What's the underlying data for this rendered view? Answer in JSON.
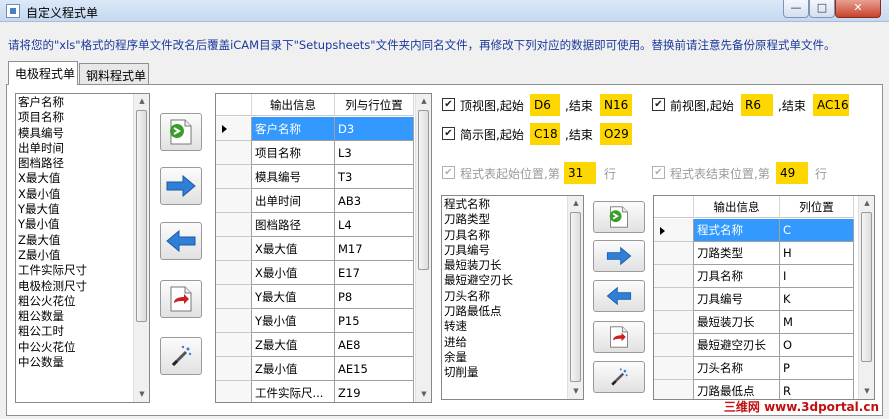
{
  "window": {
    "title": "自定义程式单",
    "min_symbol": "—",
    "max_symbol": "□",
    "close_symbol": "✕"
  },
  "notice": "请将您的\"xls\"格式的程序单文件改名后覆盖iCAM目录下\"Setupsheets\"文件夹内同名文件，再修改下列对应的数据即可使用。替换前请注意先备份原程式单文件。",
  "tabs": [
    {
      "label": "电极程式单",
      "active": true
    },
    {
      "label": "钢料程式单",
      "active": false
    }
  ],
  "left_list": [
    "客户名称",
    "项目名称",
    "模具编号",
    "出单时间",
    "图档路径",
    "X最大值",
    "X最小值",
    "Y最大值",
    "Y最小值",
    "Z最大值",
    "Z最小值",
    "工件实际尺寸",
    "电极检测尺寸",
    "粗公火花位",
    "粗公数量",
    "粗公工时",
    "中公火花位",
    "中公数量"
  ],
  "output_grid": {
    "headers": [
      "输出信息",
      "列与行位置"
    ],
    "rows": [
      [
        "客户名称",
        "D3"
      ],
      [
        "项目名称",
        "L3"
      ],
      [
        "模具编号",
        "T3"
      ],
      [
        "出单时间",
        "AB3"
      ],
      [
        "图档路径",
        "L4"
      ],
      [
        "X最大值",
        "M17"
      ],
      [
        "X最小值",
        "E17"
      ],
      [
        "Y最大值",
        "P8"
      ],
      [
        "Y最小值",
        "P15"
      ],
      [
        "Z最大值",
        "AE8"
      ],
      [
        "Z最小值",
        "AE15"
      ],
      [
        "工件实际尺...",
        "Z19"
      ]
    ],
    "selected_row": 0
  },
  "views": {
    "top": {
      "label": "顶视图,起始",
      "start": "D6",
      "end_label": ",结束",
      "end": "N16"
    },
    "front": {
      "label": "前视图,起始",
      "start": "R6",
      "end_label": ",结束",
      "end": "AC16"
    },
    "simple": {
      "label": "简示图,起始",
      "start": "C18",
      "end_label": ",结束",
      "end": "O29"
    }
  },
  "table_start": {
    "label": "程式表起始位置,第",
    "value": "31",
    "unit": "行"
  },
  "table_end": {
    "label": "程式表结束位置,第",
    "value": "49",
    "unit": "行"
  },
  "program_list": [
    "程式名称",
    "刀路类型",
    "刀具名称",
    "刀具编号",
    "最短装刀长",
    "最短避空刃长",
    "刀头名称",
    "刀路最低点",
    "转速",
    "进给",
    "余量",
    "切削量"
  ],
  "program_grid": {
    "headers": [
      "输出信息",
      "列位置"
    ],
    "rows": [
      [
        "程式名称",
        "C"
      ],
      [
        "刀路类型",
        "H"
      ],
      [
        "刀具名称",
        "I"
      ],
      [
        "刀具编号",
        "K"
      ],
      [
        "最短装刀长",
        "M"
      ],
      [
        "最短避空刃长",
        "O"
      ],
      [
        "刀头名称",
        "P"
      ],
      [
        "刀路最低点",
        "R"
      ]
    ],
    "selected_row": 0
  },
  "watermark": "三维网 www.3dportal.cn",
  "colors": {
    "highlight": "#ffd700",
    "selection": "#3399ff"
  }
}
